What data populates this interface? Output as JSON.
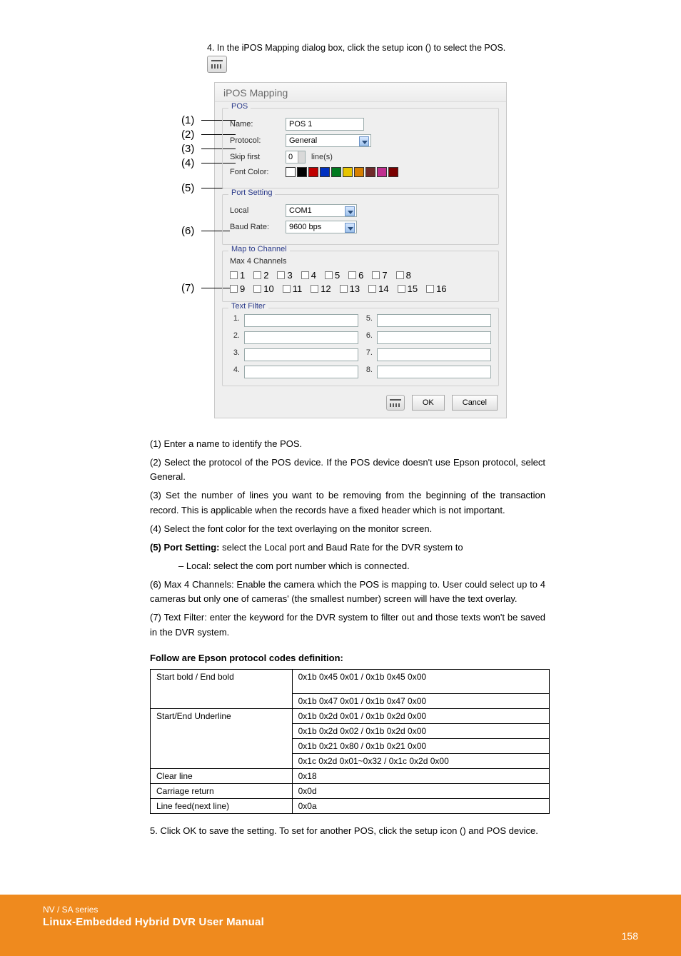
{
  "top_text": "4. In the iPOS Mapping dialog box, click the setup icon () to select the POS.",
  "dialog": {
    "title": "iPOS Mapping",
    "pos": {
      "legend": "POS",
      "name_label": "Name:",
      "name_value": "POS 1",
      "protocol_label": "Protocol:",
      "protocol_value": "General",
      "skip_label": "Skip first",
      "skip_value": "0",
      "skip_unit": "line(s)",
      "font_label": "Font Color:",
      "font_colors": [
        "#ffffff",
        "#000000",
        "#c00000",
        "#0030c0",
        "#007a1f",
        "#e6c400",
        "#d67f00",
        "#6f2a2a",
        "#c03090",
        "#7a0000"
      ]
    },
    "port": {
      "legend": "Port Setting",
      "local_label": "Local",
      "local_value": "COM1",
      "baud_label": "Baud Rate:",
      "baud_value": "9600 bps"
    },
    "map": {
      "legend": "Map to Channel",
      "note": "Max 4 Channels",
      "row1": [
        "1",
        "2",
        "3",
        "4",
        "5",
        "6",
        "7",
        "8"
      ],
      "row2": [
        "9",
        "10",
        "11",
        "12",
        "13",
        "14",
        "15",
        "16"
      ]
    },
    "filter": {
      "legend": "Text Filter",
      "left": [
        "1.",
        "2.",
        "3.",
        "4."
      ],
      "right": [
        "5.",
        "6.",
        "7.",
        "8."
      ]
    },
    "actions": {
      "ok": "OK",
      "cancel": "Cancel"
    }
  },
  "callouts": [
    "(1)",
    "(2)",
    "(3)",
    "(4)",
    "(5)",
    "(6)",
    "(7)"
  ],
  "body": {
    "p1": "(1) Enter a name to identify the POS.",
    "p2": "(2) Select the protocol of the POS device. If the POS device doesn't use Epson protocol, select General.",
    "p3": "(3) Set the number of lines you want to be removing from the beginning of the transaction record. This is applicable when the records have a fixed header which is not important.",
    "p4": "(4) Select the font color for the text overlaying on the monitor screen.",
    "p5a_label": "(5) Port Setting:",
    "p5a_body": " select the Local port and Baud Rate for the DVR system to",
    "p5b": "– Local: select the com port number which is connected.",
    "p6": "(6) Max 4 Channels: Enable the camera which the POS is mapping to. User could select up to 4 cameras but only one of cameras' (the smallest number) screen will have the text overlay.",
    "p7": "(7) Text Filter: enter the keyword for the DVR system to filter out and those texts won't be saved in the DVR system.",
    "h3": "Follow are Epson protocol codes definition:",
    "p8": "5. Click OK to save the setting. To set for another POS, click the setup icon () and POS device."
  },
  "table": {
    "rows": [
      {
        "col1": "Start bold / End bold",
        "col2_a": "0x1b 0x45 0x01 / 0x1b 0x45 0x00",
        "col2_b": "0x1b 0x47 0x01 / 0x1b 0x47 0x00"
      },
      {
        "col1": "Start/End Underline",
        "col2_a": "0x1b 0x2d 0x01 / 0x1b 0x2d 0x00",
        "col2_b": "0x1b 0x2d 0x02 / 0x1b 0x2d 0x00",
        "col2_c": "0x1b 0x21 0x80 / 0x1b 0x21 0x00",
        "col2_d": "0x1c 0x2d 0x01~0x32 / 0x1c 0x2d 0x00"
      },
      {
        "col1": "Clear line",
        "col2_a": "0x18"
      },
      {
        "col1": "Carriage return",
        "col2_a": "0x0d"
      },
      {
        "col1": "Line feed(next line)",
        "col2_a": "0x0a"
      }
    ]
  },
  "footer": {
    "line1": "NV / SA series",
    "line2": "Linux-Embedded Hybrid DVR User Manual",
    "page": "158"
  }
}
